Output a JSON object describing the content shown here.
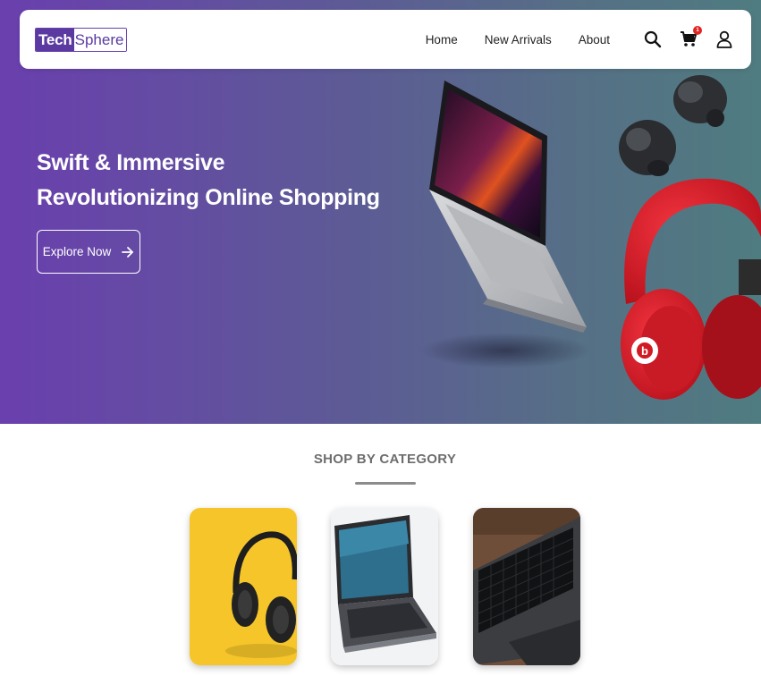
{
  "brand": {
    "logo_part1": "Tech",
    "logo_part2": "Sphere"
  },
  "nav": {
    "links": [
      "Home",
      "New Arrivals",
      "About"
    ],
    "cart_count": "1",
    "icons": [
      "search-icon",
      "cart-icon",
      "user-icon"
    ]
  },
  "hero": {
    "headline_line1": "Swift & Immersive",
    "headline_line2": "Revolutionizing Online Shopping",
    "cta_label": "Explore Now",
    "headphone_brand": "b"
  },
  "categories": {
    "title": "SHOP BY CATEGORY",
    "items": [
      {
        "name": "headphones",
        "image": "headphones on yellow background"
      },
      {
        "name": "laptops",
        "image": "laptop on white background"
      },
      {
        "name": "keyboards",
        "image": "black keyboard on desk"
      }
    ]
  },
  "colors": {
    "hero_gradient_start": "#6a3fae",
    "hero_gradient_end": "#4f7c80",
    "brand_purple": "#5a3aa0",
    "cart_badge": "#e02424"
  }
}
